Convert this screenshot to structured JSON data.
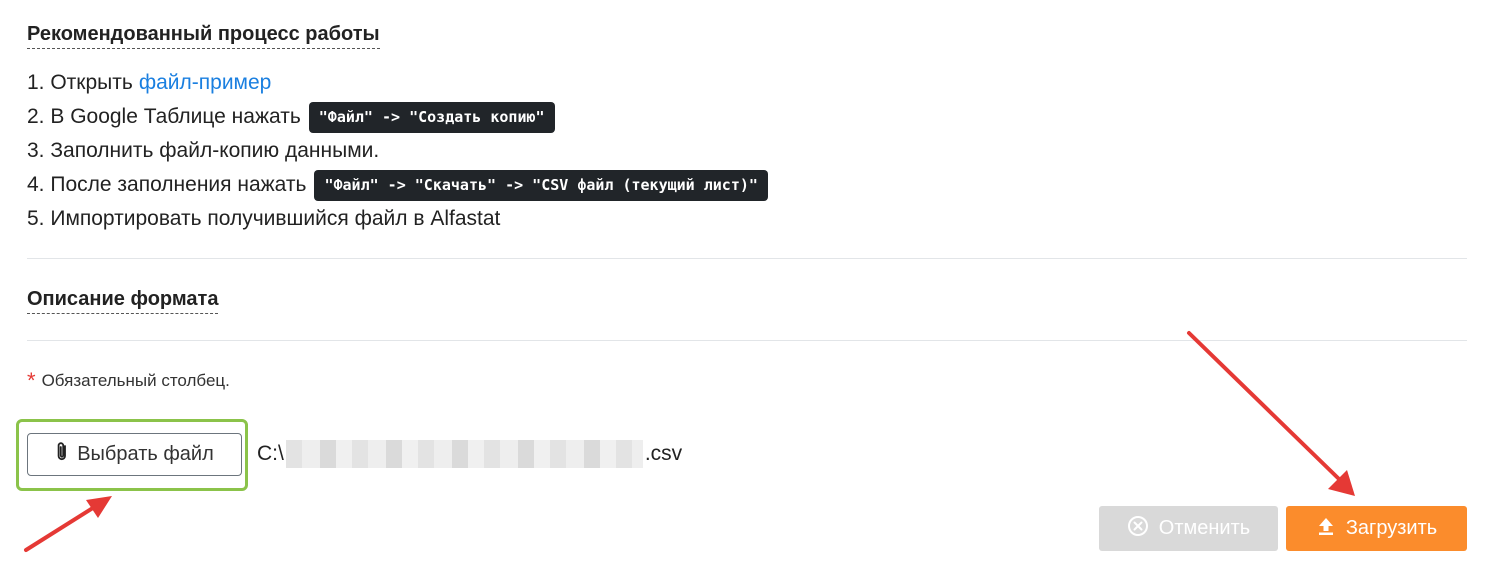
{
  "process": {
    "title": "Рекомендованный процесс работы",
    "step1_text": "1. Открыть",
    "step1_link": "файл-пример",
    "step2_text": "2. В Google Таблице нажать",
    "step2_code": "\"Файл\" -> \"Создать копию\"",
    "step3_text": "3. Заполнить файл-копию данными.",
    "step4_text": "4. После заполнения нажать",
    "step4_code": "\"Файл\" -> \"Скачать\" -> \"CSV файл (текущий лист)\"",
    "step5_text": "5. Импортировать получившийся файл в Alfastat"
  },
  "format": {
    "title": "Описание формата",
    "required_star": "*",
    "required_note": "Обязательный столбец."
  },
  "file": {
    "button_label": "Выбрать файл",
    "path_prefix": "C:\\",
    "path_suffix": ".csv"
  },
  "actions": {
    "cancel_label": "Отменить",
    "upload_label": "Загрузить"
  },
  "colors": {
    "link": "#1a7fe0",
    "code_bg": "#212529",
    "highlight_box": "#8bc34a",
    "annotation_arrow": "#e53935",
    "upload_button": "#fb8c2c",
    "cancel_button_disabled": "#d9d9d9"
  },
  "icons": {
    "file_button": "paperclip-icon",
    "cancel": "circle-x-icon",
    "upload": "upload-icon"
  }
}
